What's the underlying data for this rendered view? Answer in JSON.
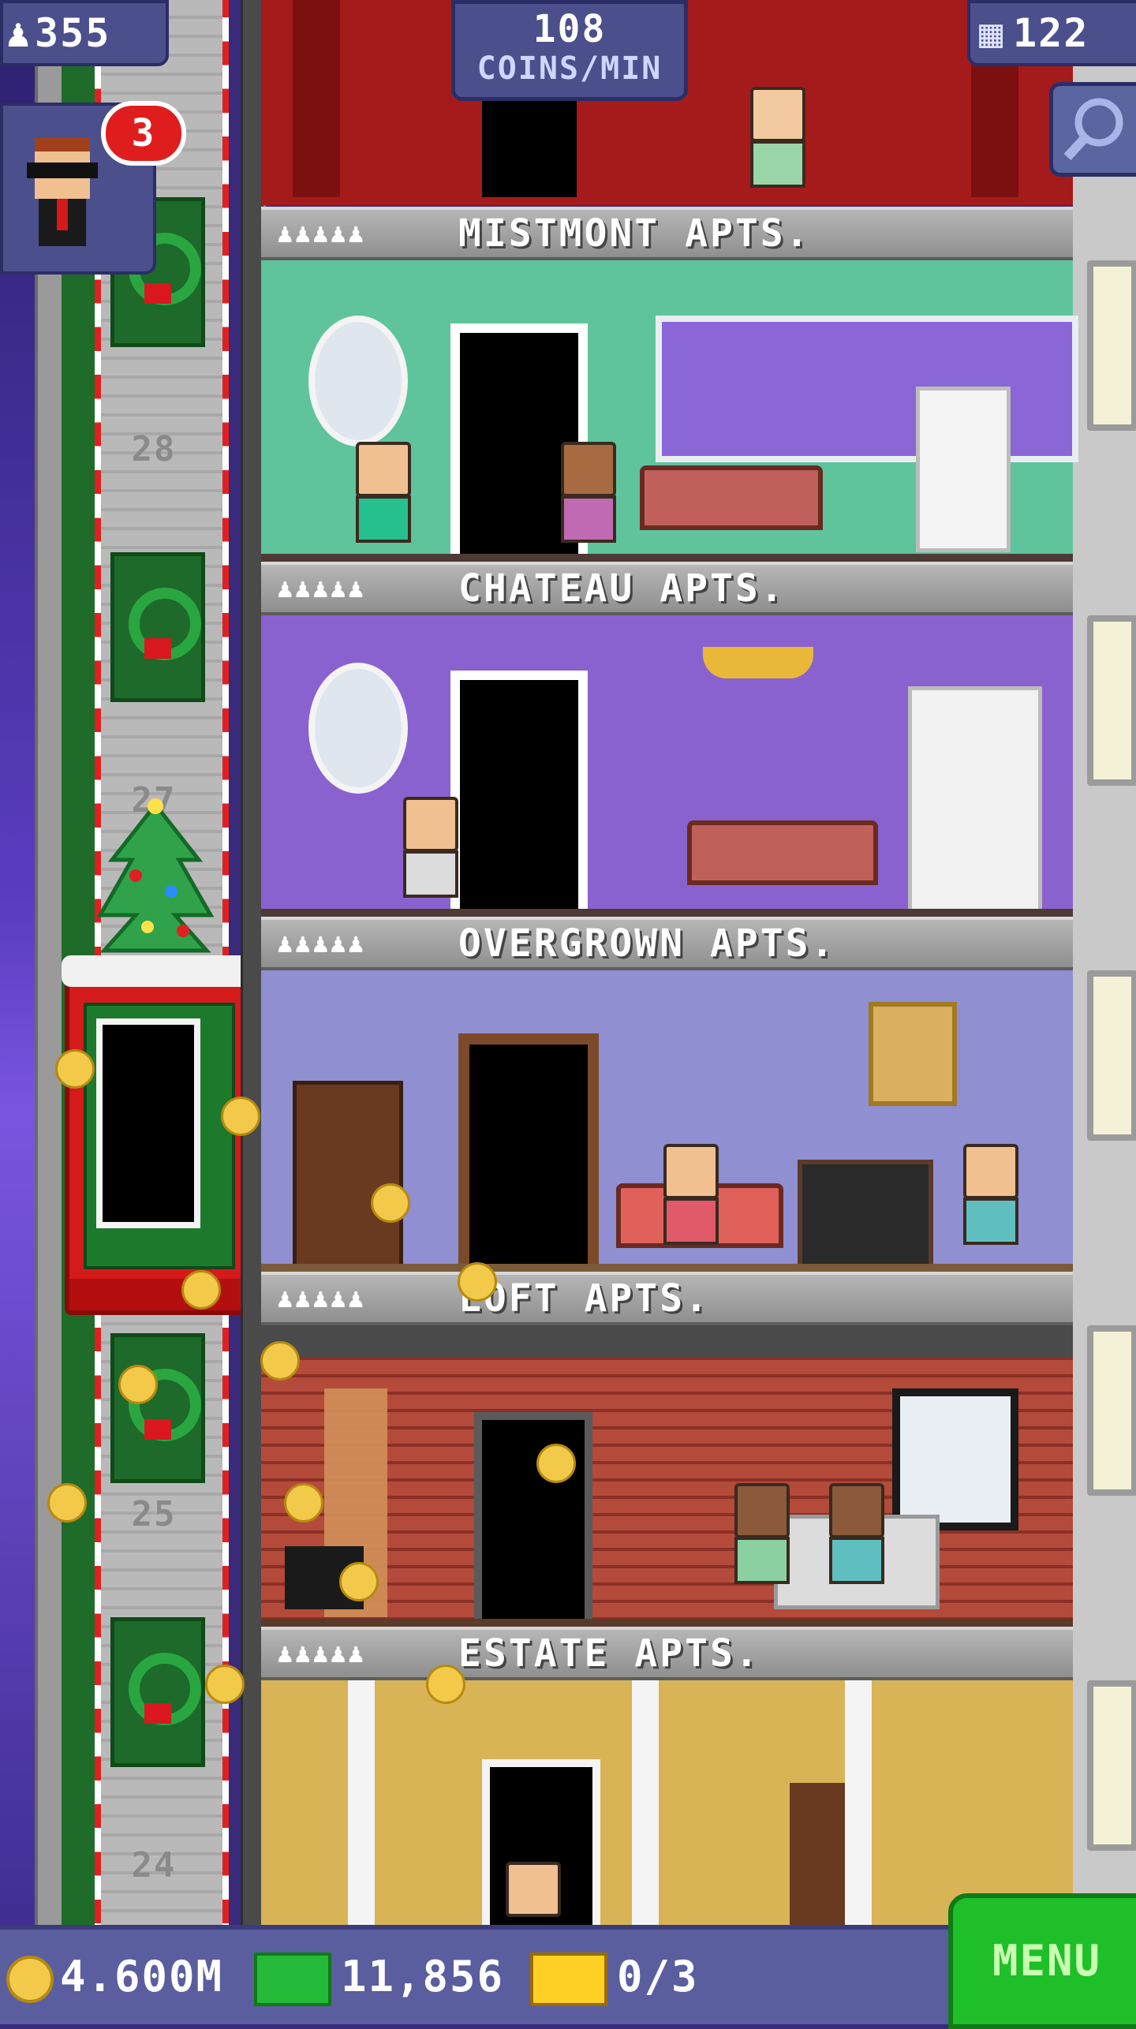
{
  "hud": {
    "population": "355",
    "coins_per_min_value": "108",
    "coins_per_min_unit": "COINS/MIN",
    "floor_count": "122",
    "vip_badge_count": "3"
  },
  "floors": [
    {
      "stars": "♟♟♟♟♟",
      "name": "MISTMONT APTS."
    },
    {
      "stars": "♟♟♟♟♟",
      "name": "CHATEAU APTS."
    },
    {
      "stars": "♟♟♟♟♟",
      "name": "OVERGROWN APTS."
    },
    {
      "stars": "♟♟♟♟♟",
      "name": "LOFT APTS."
    },
    {
      "stars": "♟♟♟♟♟",
      "name": "ESTATE APTS."
    }
  ],
  "shaft_floor_numbers": [
    "28",
    "27",
    "25",
    "24"
  ],
  "bottom_bar": {
    "coins": "4.600M",
    "bux": "11,856",
    "chests": "0/3",
    "menu_label": "MENU"
  },
  "colors": {
    "hud_bg": "#4b4f8c",
    "menu_green": "#1fbf2a",
    "badge_red": "#e01d1d",
    "coin_gold": "#f3c94a"
  },
  "icons": [
    "person-icon",
    "building-icon",
    "search-icon",
    "coin-icon",
    "bux-icon",
    "chest-icon"
  ]
}
